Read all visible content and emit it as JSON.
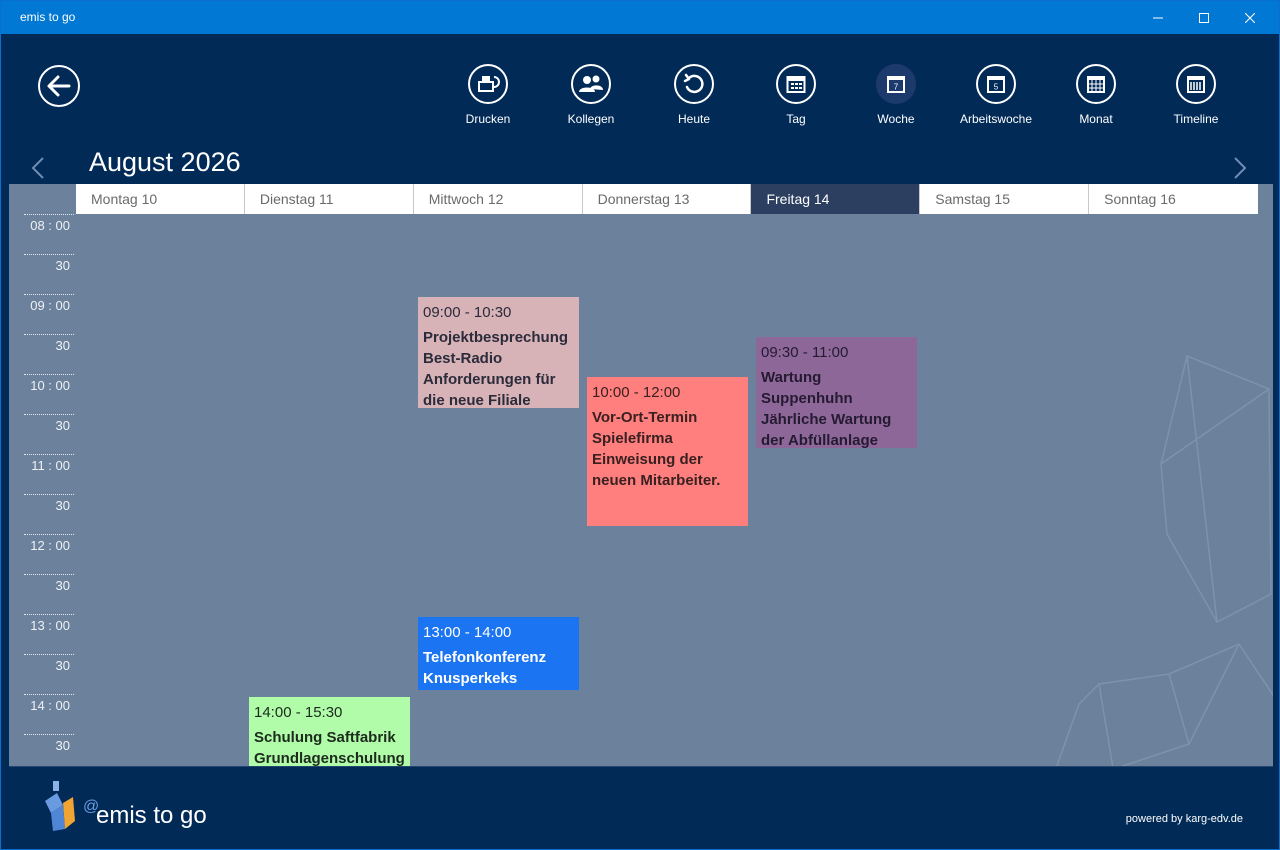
{
  "window": {
    "title": "emis to go"
  },
  "toolbar": {
    "items": [
      {
        "label": "Drucken",
        "icon": "print-icon"
      },
      {
        "label": "Kollegen",
        "icon": "colleagues-icon"
      },
      {
        "label": "Heute",
        "icon": "today-icon"
      },
      {
        "label": "Tag",
        "icon": "day-view-icon"
      },
      {
        "label": "Woche",
        "icon": "week-view-icon",
        "active": true
      },
      {
        "label": "Arbeitswoche",
        "icon": "work-week-icon"
      },
      {
        "label": "Monat",
        "icon": "month-view-icon"
      },
      {
        "label": "Timeline",
        "icon": "timeline-icon"
      }
    ]
  },
  "calendar": {
    "month_title": "August 2026",
    "days": [
      "Montag 10",
      "Dienstag 11",
      "Mittwoch 12",
      "Donnerstag 13",
      "Freitag 14",
      "Samstag 15",
      "Sonntag 16"
    ],
    "today_index": 4,
    "times": [
      "08 : 00",
      "30",
      "09 : 00",
      "30",
      "10 : 00",
      "30",
      "11 : 00",
      "30",
      "12 : 00",
      "30",
      "13 : 00",
      "30",
      "14 : 00",
      "30"
    ],
    "events": [
      {
        "day": 2,
        "start": "09:00",
        "end": "10:30",
        "time_label": "09:00 - 10:30",
        "title_lines": [
          "Projektbesprechung",
          "Best-Radio",
          "Anforderungen für",
          "die neue Filiale"
        ],
        "color": "#d7b3b8",
        "text_color": "#2b2b3a"
      },
      {
        "day": 3,
        "start": "10:00",
        "end": "12:00",
        "time_label": "10:00 - 12:00",
        "title_lines": [
          "Vor-Ort-Termin",
          "Spielefirma",
          "Einweisung der",
          "neuen Mitarbeiter."
        ],
        "color": "#fe7f7d",
        "text_color": "#3a2020"
      },
      {
        "day": 4,
        "start": "09:30",
        "end": "11:00",
        "time_label": "09:30 - 11:00",
        "title_lines": [
          "Wartung",
          "Suppenhuhn",
          "Jährliche Wartung",
          "der Abfüllanlage"
        ],
        "color": "#8e6799",
        "text_color": "#241a32"
      },
      {
        "day": 2,
        "start": "13:00",
        "end": "14:00",
        "time_label": "13:00 - 14:00",
        "title_lines": [
          "Telefonkonferenz",
          "Knusperkeks"
        ],
        "color": "#1b74f2",
        "text_color": "#ffffff"
      },
      {
        "day": 1,
        "start": "14:00",
        "end": "15:30",
        "time_label": "14:00 - 15:30",
        "title_lines": [
          "Schulung Saftfabrik",
          "Grundlagenschulung"
        ],
        "color": "#b0fca9",
        "text_color": "#1d2a1d"
      }
    ]
  },
  "footer": {
    "brand": "emis to go",
    "powered_by": "powered by karg-edv.de"
  },
  "colors": {
    "titlebar": "#0078d4",
    "header_bg": "#012a57",
    "calendar_bg": "#6c819b",
    "today_header": "#2c3f60"
  }
}
